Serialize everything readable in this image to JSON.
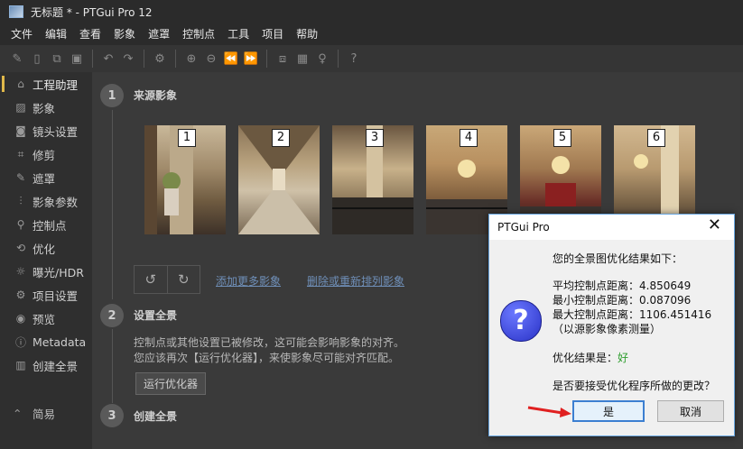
{
  "window": {
    "title": "无标题 * - PTGui Pro 12"
  },
  "menu": [
    "文件",
    "编辑",
    "查看",
    "影象",
    "遮罩",
    "控制点",
    "工具",
    "项目",
    "帮助"
  ],
  "toolbar": {
    "groups": [
      [
        "new-project-icon",
        "open-icon",
        "copy-icon",
        "save-icon"
      ],
      [
        "undo-icon",
        "redo-icon"
      ],
      [
        "settings-icon"
      ],
      [
        "zoom-in-icon",
        "zoom-out-icon",
        "rewind-icon",
        "forward-icon"
      ],
      [
        "panorama-editor-icon",
        "grid-icon",
        "lightbulb-icon"
      ],
      [
        "help-icon"
      ]
    ]
  },
  "sidebar": {
    "items": [
      {
        "label": "工程助理",
        "icon": "home-icon",
        "active": true
      },
      {
        "label": "影象",
        "icon": "image-icon"
      },
      {
        "label": "镜头设置",
        "icon": "camera-icon"
      },
      {
        "label": "修剪",
        "icon": "crop-icon"
      },
      {
        "label": "遮罩",
        "icon": "mask-icon"
      },
      {
        "label": "影象参数",
        "icon": "sliders-icon"
      },
      {
        "label": "控制点",
        "icon": "control-points-icon"
      },
      {
        "label": "优化",
        "icon": "optimize-icon"
      },
      {
        "label": "曝光/HDR",
        "icon": "sun-icon"
      },
      {
        "label": "项目设置",
        "icon": "gear-icon"
      },
      {
        "label": "预览",
        "icon": "eye-icon"
      },
      {
        "label": "Metadata",
        "icon": "info-icon"
      },
      {
        "label": "创建全景",
        "icon": "panorama-icon"
      }
    ],
    "collapse_label": "简易"
  },
  "steps": {
    "step1": {
      "number": "1",
      "title": "来源影象"
    },
    "step2": {
      "number": "2",
      "title": "设置全景"
    },
    "step3": {
      "number": "3",
      "title": "创建全景"
    }
  },
  "thumbnails": [
    "1",
    "2",
    "3",
    "4",
    "5",
    "6"
  ],
  "links": {
    "add_more": "添加更多影象",
    "remove_reorder": "删除或重新排列影象"
  },
  "step2_text": {
    "line1": "控制点或其他设置已被修改，这可能会影响影象的对齐。",
    "line2": "您应该再次【运行优化器】，来使影象尽可能对齐匹配。"
  },
  "run_optimizer_button": "运行优化器",
  "dialog": {
    "title": "PTGui Pro",
    "heading": "您的全景图优化结果如下：",
    "avg_label": "平均控制点距离：",
    "avg_value": "4.850649",
    "min_label": "最小控制点距离：",
    "min_value": "0.087096",
    "max_label": "最大控制点距离：",
    "max_value": "1106.451416",
    "unit_note": "（以源影象像素测量）",
    "result_label": "优化结果是：",
    "result_value": "好",
    "question": "是否要接受优化程序所做的更改？",
    "yes_button": "是",
    "cancel_button": "取消"
  },
  "colors": {
    "accent": "#e0b84a",
    "link": "#6f8fb8",
    "good": "#2e9e2e",
    "dialog_border": "#6aa7e0",
    "arrow": "#e02020"
  }
}
